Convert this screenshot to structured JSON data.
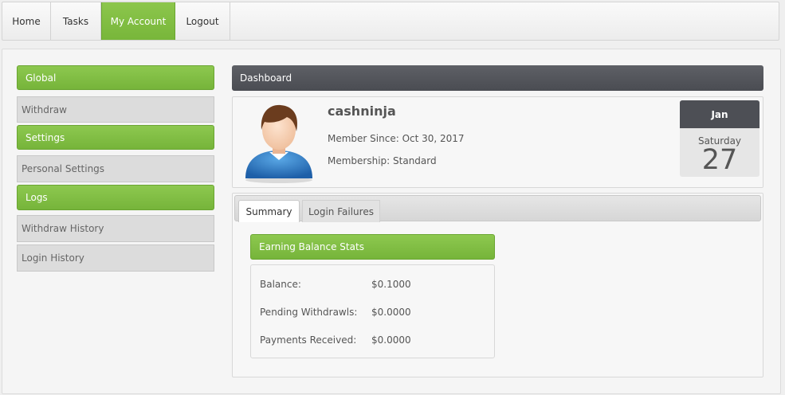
{
  "nav": {
    "items": [
      {
        "label": "Home"
      },
      {
        "label": "Tasks"
      },
      {
        "label": "My Account"
      },
      {
        "label": "Logout"
      }
    ],
    "active": "My Account"
  },
  "sidebar": {
    "global": "Global",
    "withdraw": "Withdraw",
    "settings": "Settings",
    "personal_settings": "Personal Settings",
    "logs": "Logs",
    "withdraw_history": "Withdraw History",
    "login_history": "Login History"
  },
  "dashboard": {
    "title": "Dashboard",
    "username": "cashninja",
    "member_since": "Member Since: Oct 30, 2017",
    "membership": "Membership: Standard",
    "calendar": {
      "month": "Jan",
      "weekday": "Saturday",
      "day": "27"
    }
  },
  "tabs": {
    "summary": "Summary",
    "login_failures": "Login Failures"
  },
  "stats": {
    "title": "Earning Balance Stats",
    "rows": [
      {
        "label": "Balance:",
        "value": "$0.1000"
      },
      {
        "label": "Pending Withdrawls:",
        "value": "$0.0000"
      },
      {
        "label": "Payments Received:",
        "value": "$0.0000"
      }
    ]
  },
  "colors": {
    "accent_green": "#7fbd42",
    "dark_header": "#505258"
  }
}
